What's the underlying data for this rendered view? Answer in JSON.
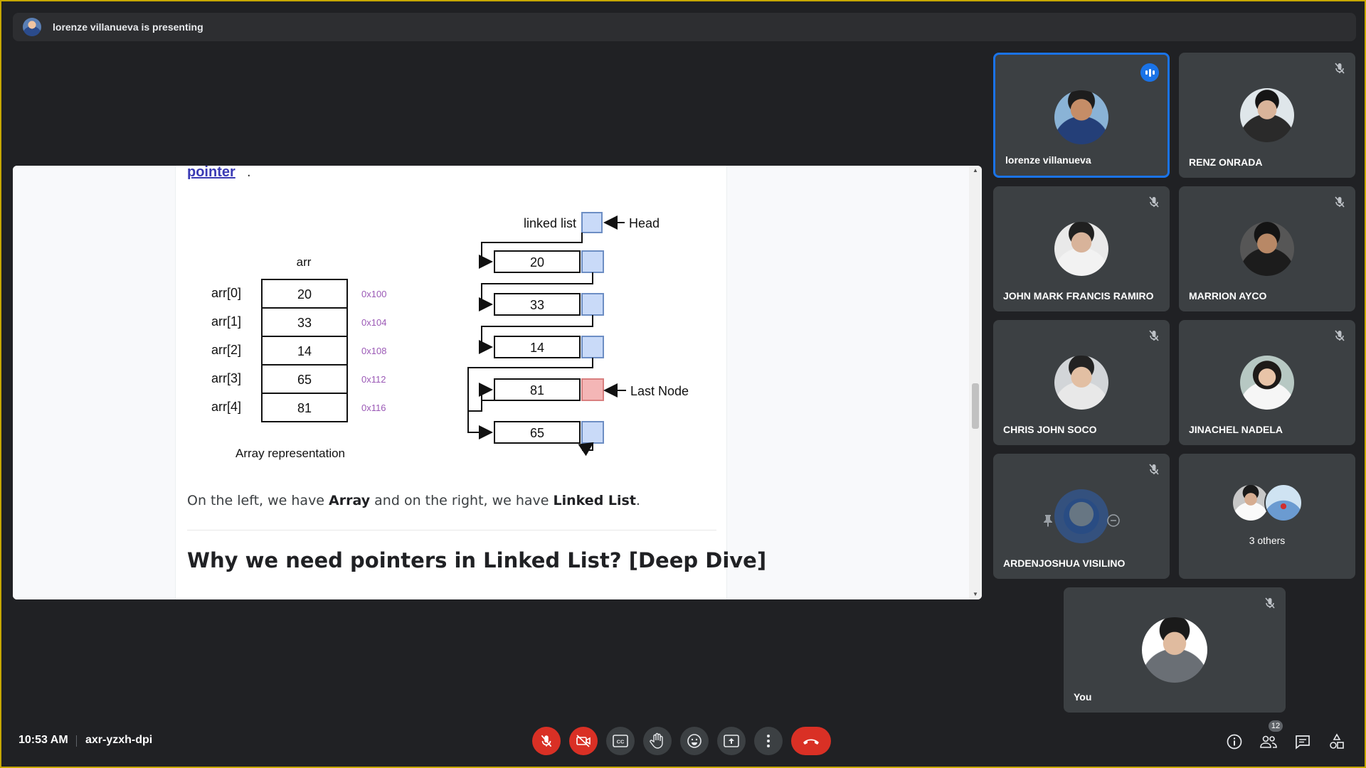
{
  "presenting_bar": {
    "text": "lorenze villanueva is presenting"
  },
  "shared_screen": {
    "link_text": "pointer",
    "link_trailing": ".",
    "figure": {
      "array_title": "arr",
      "array_labels": [
        "arr[0]",
        "arr[1]",
        "arr[2]",
        "arr[3]",
        "arr[4]"
      ],
      "array_values": [
        "20",
        "33",
        "14",
        "65",
        "81"
      ],
      "array_addresses": [
        "0x100",
        "0x104",
        "0x108",
        "0x112",
        "0x116"
      ],
      "array_caption": "Array representation",
      "list_title": "linked list",
      "head_label": "Head",
      "list_values": [
        "20",
        "33",
        "14",
        "81",
        "65"
      ],
      "last_node_label": "Last Node"
    },
    "description": {
      "part1": "On the left, we have ",
      "bold1": "Array",
      "part2": " and on the right, we have ",
      "bold2": "Linked List",
      "part3": "."
    },
    "heading": "Why we need pointers in Linked List? [Deep Dive]"
  },
  "participants": [
    {
      "name": "lorenze villanueva",
      "state": "speaking"
    },
    {
      "name": "RENZ ONRADA",
      "state": "muted"
    },
    {
      "name": "JOHN MARK FRANCIS RAMIRO",
      "state": "muted"
    },
    {
      "name": "MARRION AYCO",
      "state": "muted"
    },
    {
      "name": "CHRIS JOHN SOCO",
      "state": "muted"
    },
    {
      "name": "JINACHEL NADELA",
      "state": "muted"
    },
    {
      "name": "ARDENJOSHUA VISILINO",
      "state": "muted"
    }
  ],
  "others_tile": {
    "label": "3 others"
  },
  "self_tile": {
    "name": "You",
    "state": "muted"
  },
  "bottom_bar": {
    "time": "10:53 AM",
    "meeting_code": "axr-yzxh-dpi",
    "people_count": "12"
  },
  "colors": {
    "background": "#202124",
    "tile": "#3c4043",
    "active_border": "#1a73e8",
    "danger": "#d93025",
    "window_border": "#c6a700"
  }
}
